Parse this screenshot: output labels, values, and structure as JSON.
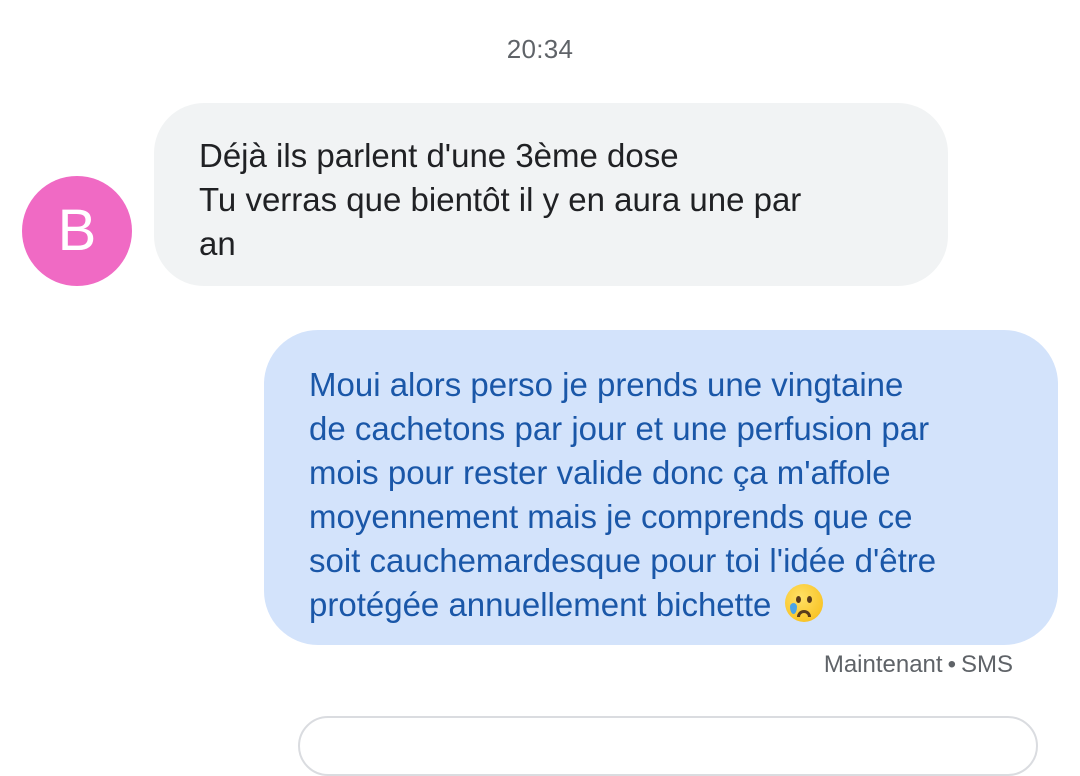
{
  "conversation": {
    "timestamp": "20:34",
    "incoming": {
      "avatar_letter": "B",
      "text": "Déjà ils parlent d'une 3ème dose\nTu verras que bientôt il y en aura une par\nan"
    },
    "outgoing": {
      "text": "Moui alors perso je prends une vingtaine\nde cachetons par jour et une perfusion par\nmois pour rester valide donc ça m'affole\nmoyennement mais je comprends que ce\nsoit cauchemardesque pour toi l'idée d'être\nprotégée annuellement bichette ",
      "emoji": "crying-face-emoji",
      "status_time": "Maintenant",
      "status_separator": "•",
      "status_type": "SMS"
    }
  },
  "colors": {
    "avatar": "#f06ac4",
    "incoming_bubble": "#f1f3f4",
    "outgoing_bubble": "#d3e3fb",
    "outgoing_text": "#1a57a8"
  }
}
